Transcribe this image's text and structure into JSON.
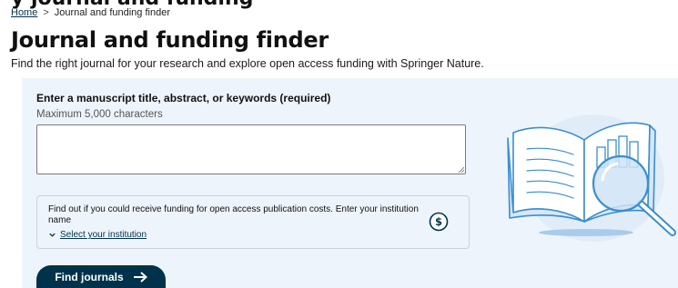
{
  "page": {
    "cropped_heading_fragment": "y journal and funding",
    "breadcrumb": {
      "home": "Home",
      "separator": ">",
      "current": "Journal and funding finder"
    },
    "title": "Journal and funding finder",
    "subtitle": "Find the right journal for your research and explore open access funding with Springer Nature."
  },
  "form": {
    "label": "Enter a manuscript title, abstract, or keywords (required)",
    "hint": "Maximum 5,000 characters",
    "value": "",
    "funding": {
      "text": "Find out if you could receive funding for open access publication costs. Enter your institution name",
      "select_label": "Select your institution",
      "icon": "dollar-circle-icon"
    },
    "submit_label": "Find journals"
  },
  "colors": {
    "brand": "#01324b",
    "panel_bg": "#eef4fb",
    "illustration_blue": "#3b8ecf"
  }
}
